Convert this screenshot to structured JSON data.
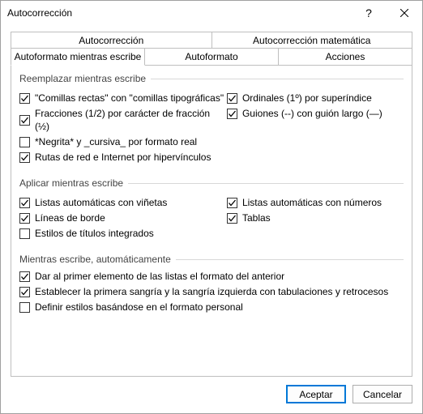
{
  "title": "Autocorrección",
  "tabs": {
    "top": [
      "Autocorrección",
      "Autocorrección matemática"
    ],
    "bot": [
      "Autoformato mientras escribe",
      "Autoformato",
      "Acciones"
    ],
    "selected": "Autoformato mientras escribe"
  },
  "groups": {
    "replace": {
      "label": "Reemplazar mientras escribe",
      "left": [
        {
          "id": "quotes",
          "label": "\"Comillas rectas\" con \"comillas tipográficas\"",
          "checked": true
        },
        {
          "id": "fractions",
          "label": "Fracciones (1/2) por carácter de fracción (½)",
          "checked": true
        },
        {
          "id": "bolditalic",
          "label": "*Negrita* y _cursiva_ por formato real",
          "checked": false
        },
        {
          "id": "hyperlinks",
          "label": "Rutas de red e Internet por hipervínculos",
          "checked": true
        }
      ],
      "right": [
        {
          "id": "ordinals",
          "label": "Ordinales (1º) por superíndice",
          "checked": true
        },
        {
          "id": "dashes",
          "label": "Guiones (--) con guión largo (—)",
          "checked": true
        }
      ]
    },
    "apply": {
      "label": "Aplicar mientras escribe",
      "left": [
        {
          "id": "bullets",
          "label": "Listas automáticas con viñetas",
          "checked": true
        },
        {
          "id": "borders",
          "label": "Líneas de borde",
          "checked": true
        },
        {
          "id": "headings",
          "label": "Estilos de títulos integrados",
          "checked": false
        }
      ],
      "right": [
        {
          "id": "numbers",
          "label": "Listas automáticas con números",
          "checked": true
        },
        {
          "id": "tables",
          "label": "Tablas",
          "checked": true
        }
      ]
    },
    "auto": {
      "label": "Mientras escribe, automáticamente",
      "items": [
        {
          "id": "format-begin",
          "label": "Dar al primer elemento de las listas el formato del anterior",
          "checked": true
        },
        {
          "id": "indent",
          "label": "Establecer la primera sangría y la sangría izquierda con tabulaciones y retrocesos",
          "checked": true
        },
        {
          "id": "define-styles",
          "label": "Definir estilos basándose en el formato personal",
          "checked": false
        }
      ]
    }
  },
  "buttons": {
    "ok": "Aceptar",
    "cancel": "Cancelar"
  }
}
